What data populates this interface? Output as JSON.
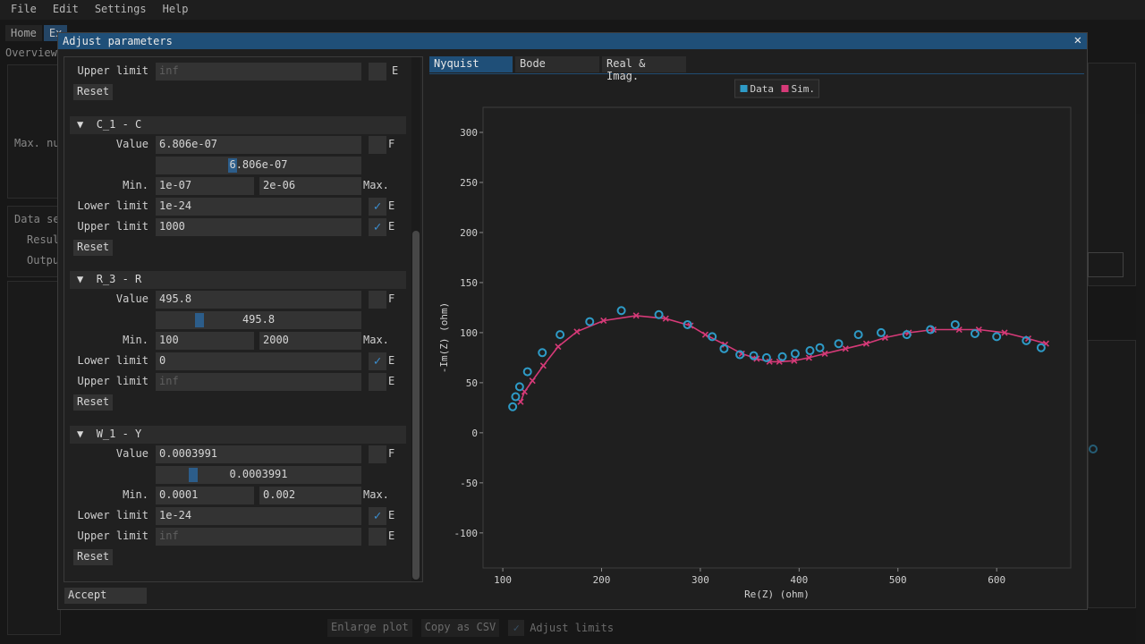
{
  "menu": [
    "File",
    "Edit",
    "Settings",
    "Help"
  ],
  "background": {
    "tabs": [
      "Home",
      "Ex"
    ],
    "overview": "Overview",
    "labels": {
      "max_num": "Max. nu",
      "data_set": "Data se",
      "result": "Resul",
      "output": "Outpu"
    },
    "bottom": {
      "enlarge": "Enlarge plot",
      "copy_csv": "Copy as CSV",
      "adjust_limits": "Adjust limits",
      "check_mark": "✓"
    }
  },
  "dialog": {
    "title": "Adjust parameters",
    "close": "✕",
    "accept": "Accept",
    "check_mark": "✓",
    "collapse_glyph": "▼",
    "labels": {
      "value": "Value",
      "min": "Min.",
      "max": "Max.",
      "lower": "Lower limit",
      "upper": "Upper limit",
      "reset": "Reset",
      "f": "F",
      "e": "E"
    },
    "top_partial": {
      "upper_value": "inf"
    },
    "sections": [
      {
        "header": "C_1 - C",
        "value": "6.806e-07",
        "slider": "6.806e-07",
        "slider_fraction": 0.37,
        "min": "1e-07",
        "max": "2e-06",
        "lower": "1e-24",
        "upper": "1000"
      },
      {
        "header": "R_3 - R",
        "value": "495.8",
        "slider": "495.8",
        "slider_fraction": 0.2,
        "min": "100",
        "max": "2000",
        "lower": "0",
        "upper": "inf"
      },
      {
        "header": "W_1 - Y",
        "value": "0.0003991",
        "slider": "0.0003991",
        "slider_fraction": 0.17,
        "min": "0.0001",
        "max": "0.002",
        "lower": "1e-24",
        "upper": "inf"
      }
    ],
    "tabs": [
      "Nyquist",
      "Bode",
      "Real & Imag."
    ]
  },
  "colors": {
    "data": "#2e9bc7",
    "sim": "#d63a78",
    "accent": "#1f4f78"
  },
  "chart_data": {
    "type": "scatter",
    "xlabel": "Re(Z) (ohm)",
    "ylabel": "-Im(Z) (ohm)",
    "xlim": [
      80,
      675
    ],
    "ylim": [
      -135,
      325
    ],
    "xticks": [
      100,
      200,
      300,
      400,
      500,
      600
    ],
    "yticks": [
      -100,
      -50,
      0,
      50,
      100,
      150,
      200,
      250,
      300
    ],
    "legend": [
      "Data",
      "Sim."
    ],
    "legend_position": "top-center",
    "series": [
      {
        "name": "Data",
        "marker": "circle",
        "x": [
          110,
          113,
          117,
          125,
          140,
          158,
          188,
          220,
          258,
          287,
          312,
          324,
          340,
          354,
          367,
          383,
          396,
          411,
          421,
          440,
          460,
          483,
          509,
          533,
          558,
          578,
          600,
          630,
          645
        ],
        "y": [
          26,
          36,
          46,
          61,
          80,
          98,
          111,
          122,
          118,
          108,
          96,
          84,
          78,
          77,
          75,
          76,
          79,
          82,
          85,
          89,
          98,
          100,
          98,
          103,
          108,
          99,
          96,
          92,
          85
        ]
      },
      {
        "name": "Sim.",
        "marker": "cross",
        "x": [
          118,
          122,
          130,
          141,
          156,
          175,
          202,
          235,
          265,
          290,
          305,
          325,
          342,
          357,
          370,
          380,
          395,
          410,
          426,
          447,
          468,
          487,
          511,
          536,
          562,
          582,
          608,
          632,
          650
        ],
        "y": [
          31,
          41,
          52,
          67,
          86,
          101,
          112,
          117,
          114,
          107,
          98,
          88,
          79,
          74,
          71,
          71,
          72,
          75,
          79,
          84,
          89,
          95,
          100,
          103,
          103,
          103,
          100,
          94,
          89
        ]
      }
    ]
  }
}
